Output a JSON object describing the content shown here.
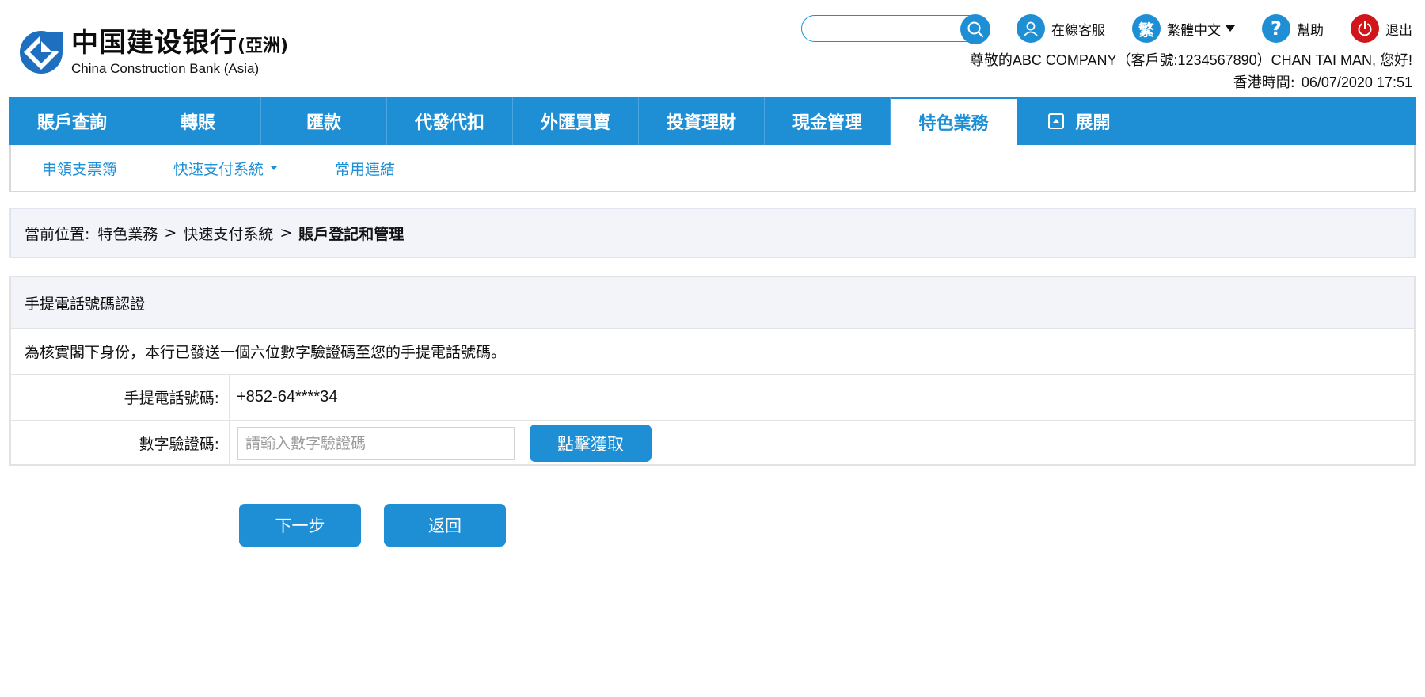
{
  "brand": {
    "name_cn": "中国建设银行",
    "name_suffix": "(亞洲)",
    "name_en": "China Construction Bank (Asia)",
    "primary_color": "#1f8fd5",
    "logout_color": "#d0161b"
  },
  "header": {
    "search": {
      "value": "",
      "placeholder": ""
    },
    "tools": [
      {
        "icon": "customer-service-icon",
        "label": "在線客服"
      },
      {
        "icon": "language-icon",
        "glyph": "繁",
        "label": "繁體中文"
      },
      {
        "icon": "help-icon",
        "glyph": "?",
        "label": "幫助"
      },
      {
        "icon": "power-icon",
        "label": "退出"
      }
    ],
    "greeting": "尊敬的ABC COMPANY（客戶號:1234567890）CHAN TAI MAN, 您好!",
    "time_label": "香港時間:",
    "time_value": "06/07/2020 17:51"
  },
  "nav": {
    "tabs": [
      {
        "label": "賬戶查詢"
      },
      {
        "label": "轉賬"
      },
      {
        "label": "匯款"
      },
      {
        "label": "代發代扣"
      },
      {
        "label": "外匯買賣"
      },
      {
        "label": "投資理財"
      },
      {
        "label": "現金管理"
      },
      {
        "label": "特色業務",
        "active": true
      }
    ],
    "expand_label": "展開",
    "sub_items": [
      {
        "label": "申領支票簿"
      },
      {
        "label": "快速支付系統",
        "has_dropdown": true
      },
      {
        "label": "常用連結"
      }
    ]
  },
  "breadcrumb": {
    "label": "當前位置:",
    "path": [
      "特色業務",
      "快速支付系統"
    ],
    "current": "賬戶登記和管理",
    "separator": ">"
  },
  "form": {
    "title": "手提電話號碼認證",
    "note": "為核實閣下身份，本行已發送一個六位數字驗證碼至您的手提電話號碼。",
    "phone_label": "手提電話號碼:",
    "phone_value": "+852-64****34",
    "otp_label": "數字驗證碼:",
    "otp_value": "",
    "otp_placeholder": "請輸入數字驗證碼",
    "get_code_label": "點擊獲取"
  },
  "actions": {
    "next_label": "下一步",
    "back_label": "返回"
  }
}
